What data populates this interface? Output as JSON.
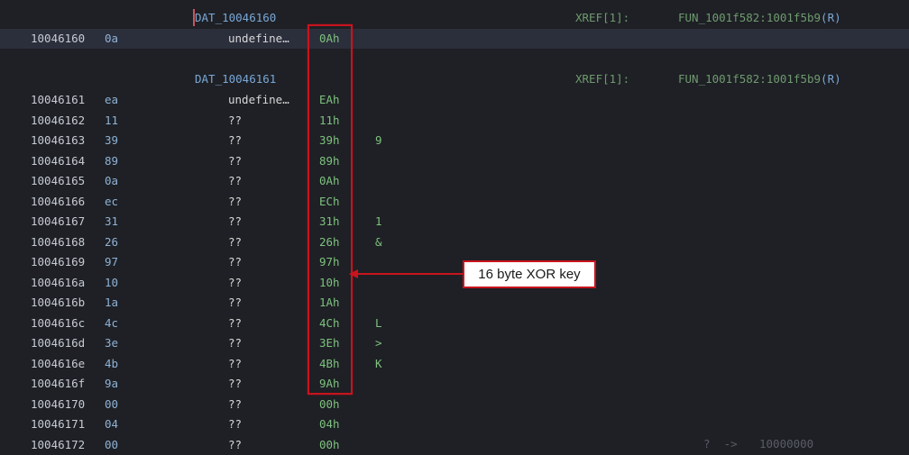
{
  "label_block_1": {
    "label": "DAT_10046160",
    "xref_label": "XREF[1]:",
    "xref_func": "FUN_1001f582:1001f5b9",
    "xref_type": "(R)"
  },
  "row_1": {
    "addr": "10046160",
    "byte": "0a",
    "mnem": "undefine…",
    "val": "0Ah",
    "chr": ""
  },
  "label_block_2": {
    "label": "DAT_10046161",
    "xref_label": "XREF[1]:",
    "xref_func": "FUN_1001f582:1001f5b9",
    "xref_type": "(R)"
  },
  "rows": [
    {
      "addr": "10046161",
      "byte": "ea",
      "mnem": "undefine…",
      "val": "EAh",
      "chr": ""
    },
    {
      "addr": "10046162",
      "byte": "11",
      "mnem": "??",
      "val": "11h",
      "chr": ""
    },
    {
      "addr": "10046163",
      "byte": "39",
      "mnem": "??",
      "val": "39h",
      "chr": "9"
    },
    {
      "addr": "10046164",
      "byte": "89",
      "mnem": "??",
      "val": "89h",
      "chr": ""
    },
    {
      "addr": "10046165",
      "byte": "0a",
      "mnem": "??",
      "val": "0Ah",
      "chr": ""
    },
    {
      "addr": "10046166",
      "byte": "ec",
      "mnem": "??",
      "val": "ECh",
      "chr": ""
    },
    {
      "addr": "10046167",
      "byte": "31",
      "mnem": "??",
      "val": "31h",
      "chr": "1"
    },
    {
      "addr": "10046168",
      "byte": "26",
      "mnem": "??",
      "val": "26h",
      "chr": "&"
    },
    {
      "addr": "10046169",
      "byte": "97",
      "mnem": "??",
      "val": "97h",
      "chr": ""
    },
    {
      "addr": "1004616a",
      "byte": "10",
      "mnem": "??",
      "val": "10h",
      "chr": ""
    },
    {
      "addr": "1004616b",
      "byte": "1a",
      "mnem": "??",
      "val": "1Ah",
      "chr": ""
    },
    {
      "addr": "1004616c",
      "byte": "4c",
      "mnem": "??",
      "val": "4Ch",
      "chr": "L"
    },
    {
      "addr": "1004616d",
      "byte": "3e",
      "mnem": "??",
      "val": "3Eh",
      "chr": ">"
    },
    {
      "addr": "1004616e",
      "byte": "4b",
      "mnem": "??",
      "val": "4Bh",
      "chr": "K"
    },
    {
      "addr": "1004616f",
      "byte": "9a",
      "mnem": "??",
      "val": "9Ah",
      "chr": ""
    },
    {
      "addr": "10046170",
      "byte": "00",
      "mnem": "??",
      "val": "00h",
      "chr": ""
    },
    {
      "addr": "10046171",
      "byte": "04",
      "mnem": "??",
      "val": "04h",
      "chr": ""
    },
    {
      "addr": "10046172",
      "byte": "00",
      "mnem": "??",
      "val": "00h",
      "chr": ""
    }
  ],
  "tail": {
    "q": "?",
    "arrow": "->",
    "target": "10000000"
  },
  "annotation": {
    "text": "16 byte XOR key"
  },
  "colors": {
    "highlight_box": "#c8141d",
    "background": "#1e2025",
    "value_green": "#7ec27e"
  }
}
